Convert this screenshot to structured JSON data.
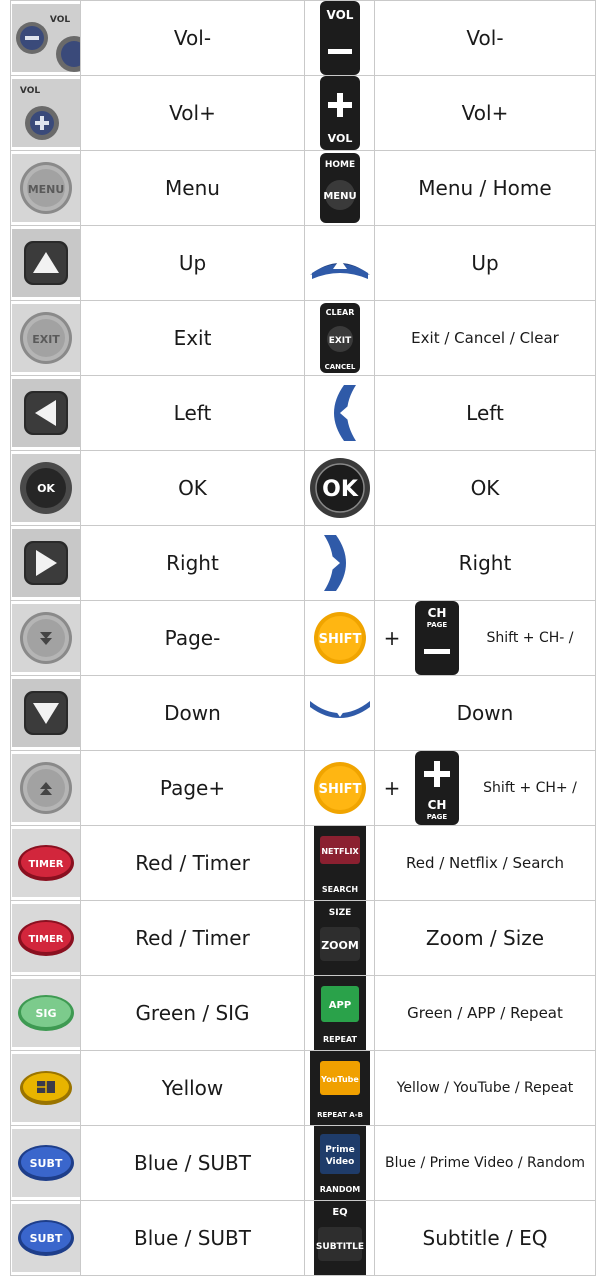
{
  "rows": [
    {
      "icon": "vol-minus-round-icon",
      "label": "Vol-",
      "icon2": "vol-minus-rocker-icon",
      "label2": "Vol-"
    },
    {
      "icon": "vol-plus-round-icon",
      "label": "Vol+",
      "icon2": "vol-plus-rocker-icon",
      "label2": "Vol+"
    },
    {
      "icon": "menu-round-icon",
      "label": "Menu",
      "icon2": "menu-home-icon",
      "label2": "Menu / Home"
    },
    {
      "icon": "up-square-icon",
      "label": "Up",
      "icon2": "up-arc-icon",
      "label2": "Up"
    },
    {
      "icon": "exit-round-icon",
      "label": "Exit",
      "icon2": "exit-clear-cancel-icon",
      "label2": "Exit / Cancel / Clear"
    },
    {
      "icon": "left-square-icon",
      "label": "Left",
      "icon2": "left-arc-icon",
      "label2": "Left"
    },
    {
      "icon": "ok-round-icon",
      "label": "OK",
      "icon2": "ok-big-icon",
      "label2": "OK"
    },
    {
      "icon": "right-square-icon",
      "label": "Right",
      "icon2": "right-arc-icon",
      "label2": "Right"
    },
    {
      "icon": "page-minus-round-icon",
      "label": "Page-",
      "icon2": "shift-icon",
      "label2": "",
      "combo": {
        "plus": "+",
        "icon": "ch-page-minus-icon",
        "text": "Shift + CH- /"
      }
    },
    {
      "icon": "down-square-icon",
      "label": "Down",
      "icon2": "down-arc-icon",
      "label2": "Down"
    },
    {
      "icon": "page-plus-round-icon",
      "label": "Page+",
      "icon2": "shift-icon",
      "label2": "",
      "combo": {
        "plus": "+",
        "icon": "ch-page-plus-icon",
        "text": "Shift + CH+ /"
      }
    },
    {
      "icon": "timer-red-icon",
      "label": "Red / Timer",
      "icon2": "netflix-search-icon",
      "label2": "Red / Netflix / Search"
    },
    {
      "icon": "timer-red-icon",
      "label": "Red / Timer",
      "icon2": "zoom-size-icon",
      "label2": "Zoom / Size"
    },
    {
      "icon": "sig-green-icon",
      "label": "Green / SIG",
      "icon2": "app-repeat-icon",
      "label2": "Green / APP / Repeat"
    },
    {
      "icon": "yellow-button-icon",
      "label": "Yellow",
      "icon2": "youtube-repeat-ab-icon",
      "label2": "Yellow / YouTube / Repeat"
    },
    {
      "icon": "subt-blue-icon",
      "label": "Blue / SUBT",
      "icon2": "prime-video-random-icon",
      "label2": "Blue / Prime Video / Random"
    },
    {
      "icon": "subt-blue-icon",
      "label": "Blue / SUBT",
      "icon2": "subtitle-eq-icon",
      "label2": "Subtitle / EQ"
    }
  ],
  "icon_text": {
    "vol": "VOL",
    "menu": "MENU",
    "home": "HOME",
    "exit": "EXIT",
    "clear": "CLEAR",
    "cancel": "CANCEL",
    "ok_small": "OK",
    "ok_big": "OK",
    "shift": "SHIFT",
    "ch": "CH",
    "page": "PAGE",
    "timer": "TIMER",
    "netflix": "NETFLIX",
    "search": "SEARCH",
    "size": "SIZE",
    "zoom": "ZOOM",
    "sig": "SIG",
    "app": "APP",
    "repeat": "REPEAT",
    "youtube": "YouTube",
    "repeat_ab": "REPEAT A-B",
    "subt": "SUBT",
    "prime": "Prime",
    "video": "Video",
    "random": "RANDOM",
    "eq": "EQ",
    "subtitle": "SUBTITLE"
  }
}
